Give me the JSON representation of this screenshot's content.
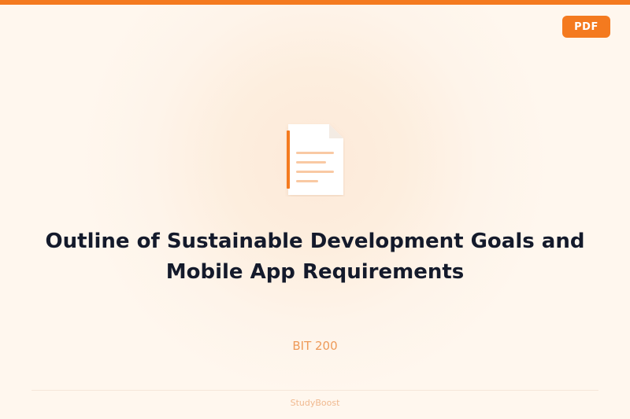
{
  "header": {
    "badge_label": "PDF"
  },
  "document": {
    "icon": "document-icon",
    "title": "Outline of Sustainable Development Goals and Mobile App Requirements",
    "course_code": "BIT 200"
  },
  "footer": {
    "brand": "StudyBoost"
  },
  "colors": {
    "accent": "#f47a1f",
    "title": "#141a2b",
    "subtitle": "#ee9a59",
    "background": "#fff7ee"
  }
}
